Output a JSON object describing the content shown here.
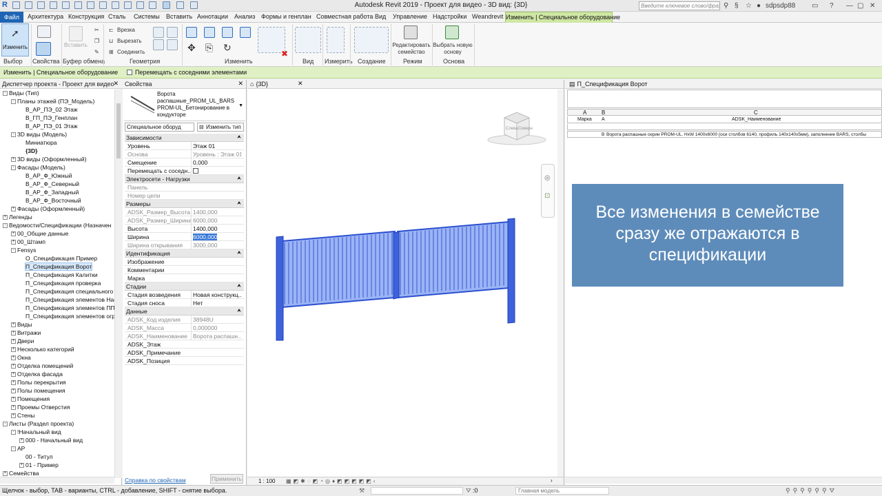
{
  "titlebar": {
    "app_title": "Autodesk Revit 2019 - Проект для видео - 3D вид: {3D}",
    "search_placeholder": "Введите ключевое слово/фразу",
    "user": "sdpsdp88"
  },
  "ribbon_tabs": [
    "Архитектура",
    "Конструкция",
    "Сталь",
    "Системы",
    "Вставить",
    "Аннотации",
    "Анализ",
    "Формы и генплан",
    "Совместная работа",
    "Вид",
    "Управление",
    "Надстройки",
    "Weandrevit"
  ],
  "file_tab": "Файл",
  "active_tab": "Изменить | Специальное оборудование",
  "ribbon": {
    "modify_label": "Изменить",
    "paste_label": "Вставить",
    "cut_label": "Врезка",
    "cut2_label": "Вырезать",
    "join_label": "Соединить",
    "edit_family": "Редактировать семейство",
    "pick_host": "Выбрать новую основу",
    "groups": [
      "Выбор",
      "Свойства",
      "Буфер обмена",
      "Геометрия",
      "Изменить",
      "Вид",
      "Измерить",
      "Создание",
      "Режим",
      "Основа"
    ]
  },
  "optbar": {
    "context": "Изменить | Специальное оборудование",
    "checkbox_label": "Перемещать с соседними элементами"
  },
  "browser": {
    "title": "Диспетчер проекта - Проект для видео",
    "items": [
      {
        "text": "Виды (Тип)",
        "level": 0,
        "toggle": "-"
      },
      {
        "text": "Планы этажей (ПЭ_Модель)",
        "level": 1,
        "toggle": "-"
      },
      {
        "text": "В_АР_ПЭ_02 Этаж",
        "level": 2,
        "toggle": ""
      },
      {
        "text": "В_ГП_ПЭ_Генплан",
        "level": 2,
        "toggle": ""
      },
      {
        "text": "В_АР_ПЭ_01 Этаж",
        "level": 2,
        "toggle": ""
      },
      {
        "text": "3D виды (Модель)",
        "level": 1,
        "toggle": "-"
      },
      {
        "text": "Миниатюра",
        "level": 2,
        "toggle": ""
      },
      {
        "text": "{3D}",
        "level": 2,
        "toggle": "",
        "bold": true
      },
      {
        "text": "3D виды (Оформленный)",
        "level": 1,
        "toggle": "+"
      },
      {
        "text": "Фасады (Модель)",
        "level": 1,
        "toggle": "-"
      },
      {
        "text": "В_АР_Ф_Южный",
        "level": 2,
        "toggle": ""
      },
      {
        "text": "В_АР_Ф_Северный",
        "level": 2,
        "toggle": ""
      },
      {
        "text": "В_АР_Ф_Западный",
        "level": 2,
        "toggle": ""
      },
      {
        "text": "В_АР_Ф_Восточный",
        "level": 2,
        "toggle": ""
      },
      {
        "text": "Фасады (Оформленный)",
        "level": 1,
        "toggle": "+"
      },
      {
        "text": "Легенды",
        "level": 0,
        "toggle": "+"
      },
      {
        "text": "Ведомости/Спецификации (Назначен",
        "level": 0,
        "toggle": "-"
      },
      {
        "text": "00_Общие данные",
        "level": 1,
        "toggle": "+"
      },
      {
        "text": "00_Штамп",
        "level": 1,
        "toggle": "+"
      },
      {
        "text": "Fensys",
        "level": 1,
        "toggle": "-"
      },
      {
        "text": "О_Спецификация Пример",
        "level": 2,
        "toggle": ""
      },
      {
        "text": "П_Спецификация Ворот",
        "level": 2,
        "toggle": "",
        "selected": true
      },
      {
        "text": "П_Спецификация Калитки",
        "level": 2,
        "toggle": ""
      },
      {
        "text": "П_Спецификация проверка",
        "level": 2,
        "toggle": ""
      },
      {
        "text": "П_Спецификация специального с",
        "level": 2,
        "toggle": ""
      },
      {
        "text": "П_Спецификация элементов Нас",
        "level": 2,
        "toggle": ""
      },
      {
        "text": "П_Спецификация элементов ПП",
        "level": 2,
        "toggle": ""
      },
      {
        "text": "П_Спецификация элементов огра",
        "level": 2,
        "toggle": ""
      },
      {
        "text": "Виды",
        "level": 1,
        "toggle": "+"
      },
      {
        "text": "Витражи",
        "level": 1,
        "toggle": "+"
      },
      {
        "text": "Двери",
        "level": 1,
        "toggle": "+"
      },
      {
        "text": "Несколько категорий",
        "level": 1,
        "toggle": "+"
      },
      {
        "text": "Окна",
        "level": 1,
        "toggle": "+"
      },
      {
        "text": "Отделка помещений",
        "level": 1,
        "toggle": "+"
      },
      {
        "text": "Отделка фасада",
        "level": 1,
        "toggle": "+"
      },
      {
        "text": "Полы перекрытия",
        "level": 1,
        "toggle": "+"
      },
      {
        "text": "Полы помещения",
        "level": 1,
        "toggle": "+"
      },
      {
        "text": "Помещения",
        "level": 1,
        "toggle": "+"
      },
      {
        "text": "Проемы Отверстия",
        "level": 1,
        "toggle": "+"
      },
      {
        "text": "Стены",
        "level": 1,
        "toggle": "+"
      },
      {
        "text": "Листы (Раздел проекта)",
        "level": 0,
        "toggle": "-"
      },
      {
        "text": "!Начальный вид",
        "level": 1,
        "toggle": "-"
      },
      {
        "text": "000 - Начальный вид",
        "level": 2,
        "toggle": "+"
      },
      {
        "text": "АР",
        "level": 1,
        "toggle": "-"
      },
      {
        "text": "00 - Титул",
        "level": 2,
        "toggle": ""
      },
      {
        "text": "01 - Пример",
        "level": 2,
        "toggle": "+"
      },
      {
        "text": "Семейства",
        "level": 0,
        "toggle": "+"
      }
    ]
  },
  "props": {
    "title": "Свойства",
    "family_name": "Ворота распашные_PROM_UL_BARS PROM-UL_Бетонирование в кондукторе",
    "type_selector": "Специальное оборуд",
    "edit_type": "Изменить тип",
    "rows": [
      {
        "section": "Зависимости"
      },
      {
        "k": "Уровень",
        "v": "Этаж 01"
      },
      {
        "k": "Основа",
        "v": "Уровень : Этаж 01",
        "gray": true
      },
      {
        "k": "Смещение",
        "v": "0,000"
      },
      {
        "k": "Перемещать с соседн...",
        "v": "",
        "checkbox": true
      },
      {
        "section": "Электросети - Нагрузки"
      },
      {
        "k": "Панель",
        "v": "",
        "gray": true
      },
      {
        "k": "Номер цепи",
        "v": "",
        "gray": true
      },
      {
        "section": "Размеры"
      },
      {
        "k": "ADSK_Размер_Высота",
        "v": "1400,000",
        "gray": true
      },
      {
        "k": "ADSK_Размер_Ширина",
        "v": "6000,000",
        "gray": true
      },
      {
        "k": "Высота",
        "v": "1400,000"
      },
      {
        "k": "Ширина",
        "v": "6000,000",
        "highlight": true
      },
      {
        "k": "Ширина открывания",
        "v": "3000,000",
        "gray": true
      },
      {
        "section": "Идентификация"
      },
      {
        "k": "Изображение",
        "v": ""
      },
      {
        "k": "Комментарии",
        "v": ""
      },
      {
        "k": "Марка",
        "v": ""
      },
      {
        "section": "Стадии"
      },
      {
        "k": "Стадия возведения",
        "v": "Новая конструкц..."
      },
      {
        "k": "Стадия сноса",
        "v": "Нет"
      },
      {
        "section": "Данные"
      },
      {
        "k": "ADSK_Код изделия",
        "v": "38948U",
        "gray": true
      },
      {
        "k": "ADSK_Масса",
        "v": "0,000000",
        "gray": true
      },
      {
        "k": "ADSK_Наименование",
        "v": "Ворота распашн...",
        "gray": true
      },
      {
        "k": "ADSK_Этаж",
        "v": ""
      },
      {
        "k": "ADSK_Примечание",
        "v": ""
      },
      {
        "k": "ADSK_Позиция",
        "v": ""
      }
    ],
    "help_link": "Справка по свойствам",
    "apply_button": "Применить"
  },
  "view3d": {
    "tab_label": "{3D}",
    "scale": "1 : 100",
    "cube_left": "Слева",
    "cube_right": "Северн"
  },
  "schedule": {
    "tab_label": "П_Спецификация Ворот",
    "col_letters": [
      "A",
      "B",
      "C"
    ],
    "headers": [
      "Марка",
      "А",
      "ADSK_Наименование"
    ],
    "row": [
      "",
      "В",
      "Ворота распашные серии PROM-UL. HxW 1400x6000 (оси столбов 6140, профиль 140х140х5мм), заполнение BARS, столбы"
    ]
  },
  "overlay": {
    "text": "Все изменения в семействе сразу же отражаются в спецификации"
  },
  "statusbar": {
    "hint": "Щелчок - выбор, TAB - варианты, CTRL - добавление, SHIFT - снятие выбора.",
    "count": ":0",
    "model": "Главная модель"
  },
  "colors": {
    "accent": "#1e64b4",
    "gate_fill": "#7f9ff0",
    "gate_frame": "#2b4fd0",
    "overlay_bg": "#5e8cba",
    "context_tab": "#cfe7a4"
  }
}
